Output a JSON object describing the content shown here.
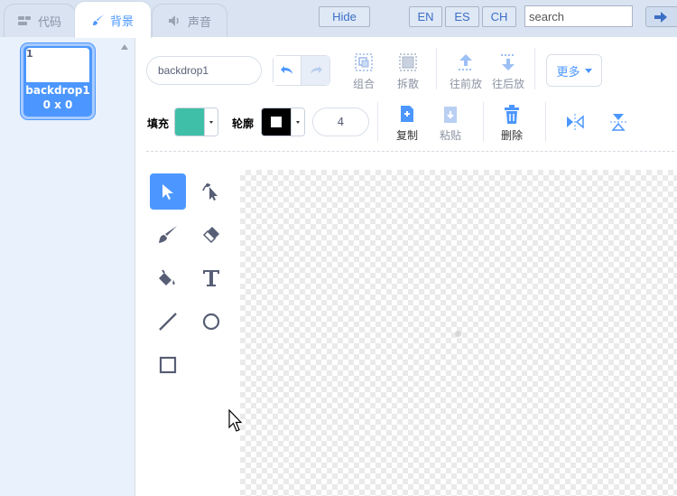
{
  "tabs": [
    {
      "label": "代码",
      "icon": "code-icon"
    },
    {
      "label": "背景",
      "icon": "brush-icon",
      "active": true
    },
    {
      "label": "声音",
      "icon": "speaker-icon"
    }
  ],
  "topbar": {
    "hide_label": "Hide",
    "lang_en": "EN",
    "lang_es": "ES",
    "lang_ch": "CH",
    "search_placeholder": "search",
    "go_icon": "arrow-right-icon"
  },
  "backdrops": [
    {
      "index": "1",
      "name": "backdrop1",
      "size": "0 x 0"
    }
  ],
  "editor": {
    "costume_name": "backdrop1",
    "group_label": "组合",
    "ungroup_label": "拆散",
    "forward_label": "往前放",
    "backward_label": "往后放",
    "more_label": "更多",
    "fill_label": "填充",
    "outline_label": "轮廓",
    "outline_width": "4",
    "copy_label": "复制",
    "paste_label": "粘贴",
    "delete_label": "删除"
  },
  "colors": {
    "accent": "#4c97ff",
    "fill": "#3fbfa7",
    "outline": "#000000"
  },
  "tools": [
    "select-icon",
    "reshape-icon",
    "brush-icon",
    "eraser-icon",
    "fill-icon",
    "text-icon",
    "line-icon",
    "circle-icon",
    "rectangle-icon"
  ]
}
